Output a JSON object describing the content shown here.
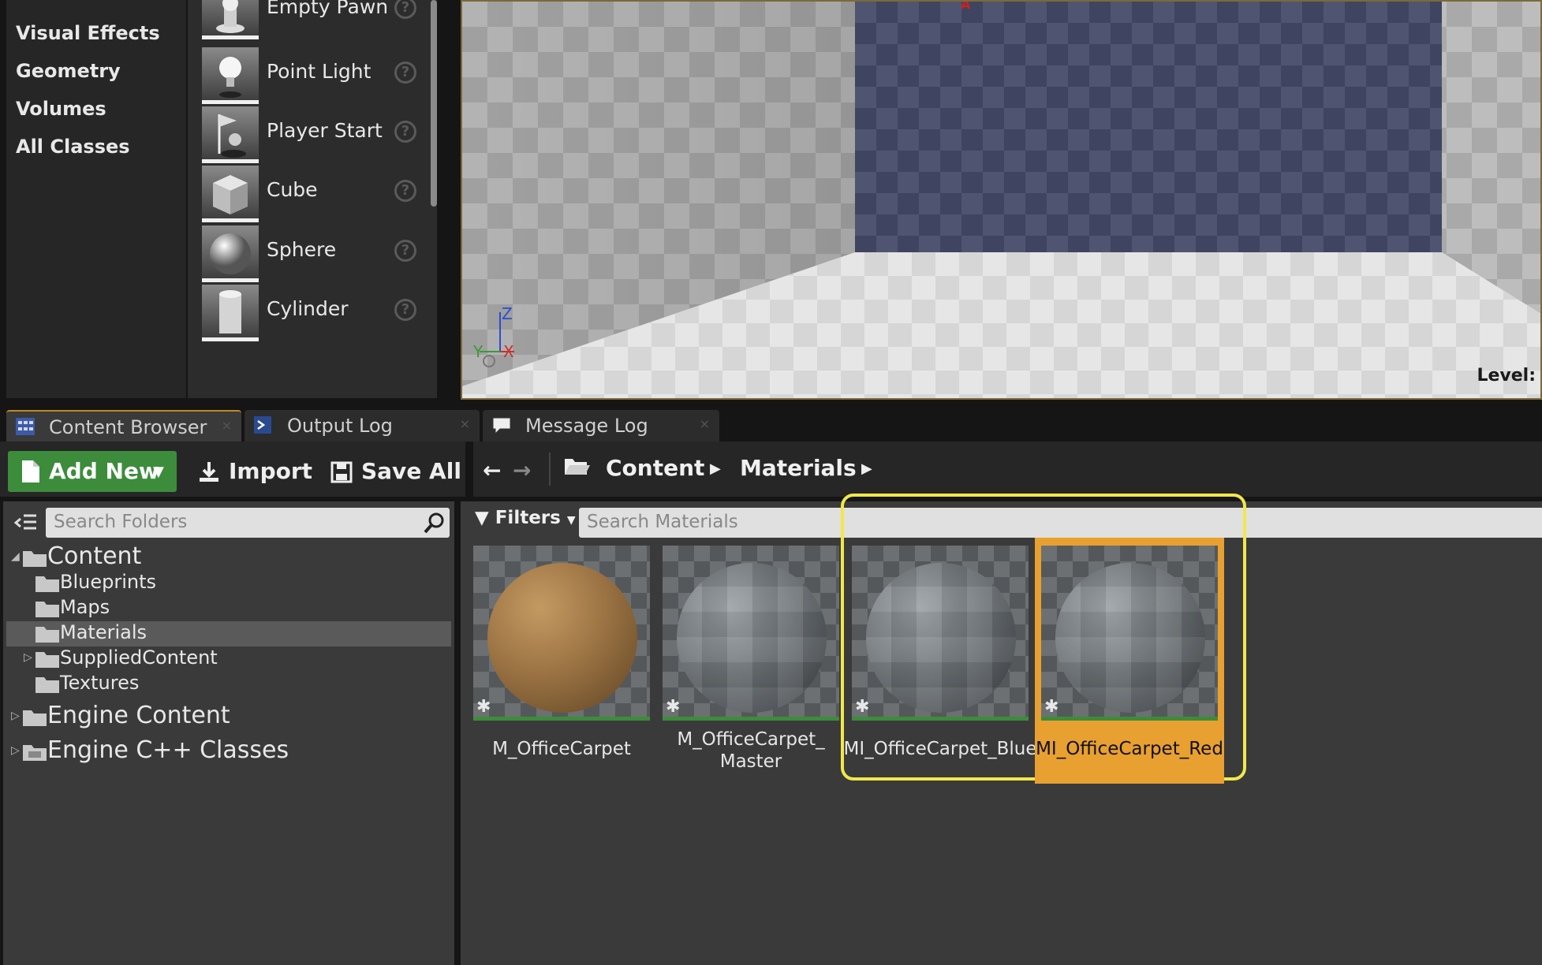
{
  "place_actors": {
    "categories": [
      "Visual Effects",
      "Geometry",
      "Volumes",
      "All Classes"
    ],
    "actors": [
      {
        "label": "Empty Pawn",
        "icon": "pawn-icon"
      },
      {
        "label": "Point Light",
        "icon": "light-bulb-icon"
      },
      {
        "label": "Player Start",
        "icon": "player-start-icon"
      },
      {
        "label": "Cube",
        "icon": "cube-icon"
      },
      {
        "label": "Sphere",
        "icon": "sphere-icon"
      },
      {
        "label": "Cylinder",
        "icon": "cylinder-icon"
      }
    ],
    "help_glyph": "?"
  },
  "viewport": {
    "level_label": "Level:",
    "axis_labels": {
      "z": "Z",
      "y": "Y",
      "x": "X"
    },
    "marker_label": "A"
  },
  "tabs": [
    {
      "label": "Content Browser",
      "icon": "content-browser-icon",
      "active": true
    },
    {
      "label": "Output Log",
      "icon": "output-log-icon",
      "active": false
    },
    {
      "label": "Message Log",
      "icon": "message-log-icon",
      "active": false
    }
  ],
  "tab_close_glyph": "×",
  "toolbar": {
    "add_new_label": "Add New",
    "import_label": "Import",
    "save_all_label": "Save All"
  },
  "breadcrumb": [
    "Content",
    "Materials"
  ],
  "folders": {
    "search_placeholder": "Search Folders",
    "tree": [
      {
        "label": "Content",
        "level": 0,
        "expander": "◢",
        "big": true
      },
      {
        "label": "Blueprints",
        "level": 1
      },
      {
        "label": "Maps",
        "level": 1
      },
      {
        "label": "Materials",
        "level": 1,
        "selected": true
      },
      {
        "label": "SuppliedContent",
        "level": 1,
        "expander": "▷"
      },
      {
        "label": "Textures",
        "level": 1
      },
      {
        "label": "Engine Content",
        "level": 0,
        "expander": "▷",
        "big": true
      },
      {
        "label": "Engine C++ Classes",
        "level": 0,
        "expander": "▷",
        "big": true
      }
    ]
  },
  "assets": {
    "filters_label": "Filters",
    "search_placeholder": "Search Materials",
    "items": [
      {
        "name": "M_OfficeCarpet",
        "material": "wood"
      },
      {
        "name": "M_OfficeCarpet_\nMaster",
        "material": "grey"
      },
      {
        "name": "MI_OfficeCarpet_Blue",
        "material": "grey"
      },
      {
        "name": "MI_OfficeCarpet_Red",
        "material": "grey",
        "selected": true
      }
    ]
  },
  "colors": {
    "accent_green": "#3c8c3c",
    "selection_orange": "#e8a030",
    "highlight_yellow": "#f0e84a"
  }
}
